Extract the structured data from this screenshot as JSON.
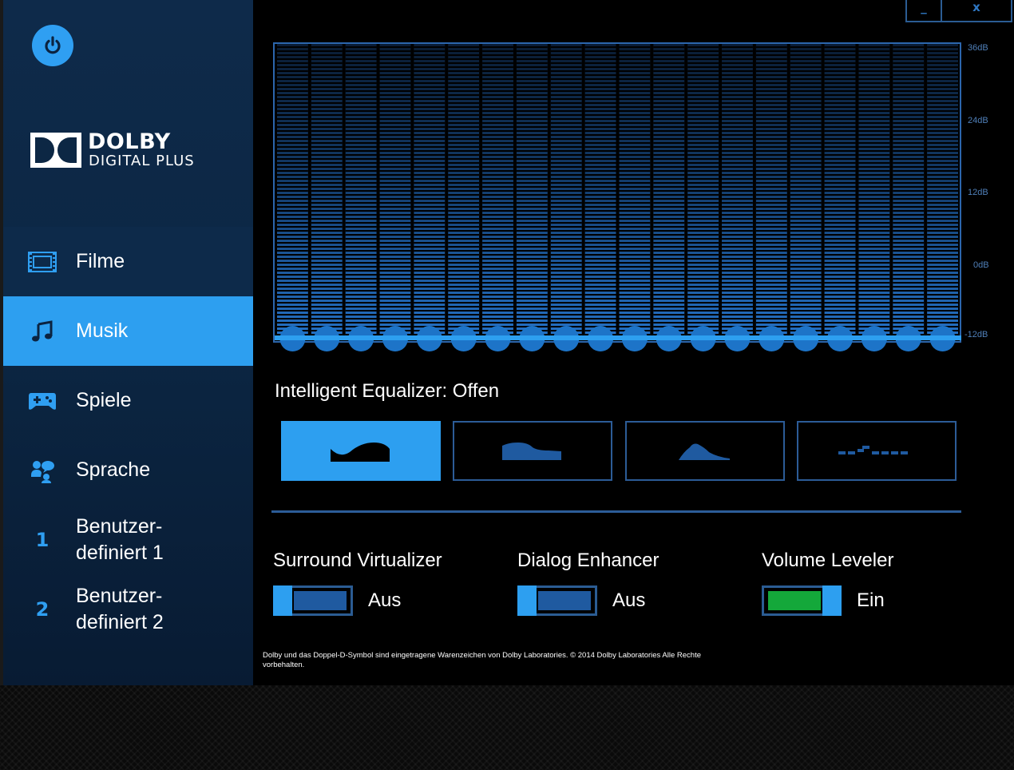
{
  "window": {
    "minimize_label": "_",
    "close_label": "x"
  },
  "brand": {
    "line1": "DOLBY",
    "line2": "DIGITAL PLUS"
  },
  "nav": {
    "items": [
      {
        "label": "Filme",
        "icon": "film-icon"
      },
      {
        "label": "Musik",
        "icon": "music-note-icon",
        "active": true
      },
      {
        "label": "Spiele",
        "icon": "gamepad-icon"
      },
      {
        "label": "Sprache",
        "icon": "voice-icon"
      },
      {
        "num": "1",
        "label_line1": "Benutzer-",
        "label_line2": "definiert 1"
      },
      {
        "num": "2",
        "label_line1": "Benutzer-",
        "label_line2": "definiert 2"
      }
    ]
  },
  "equalizer": {
    "db_labels": [
      "36dB",
      "24dB",
      "12dB",
      "0dB",
      "-12dB"
    ],
    "bands": 20,
    "title": "Intelligent Equalizer: Offen",
    "presets": [
      {
        "icon": "curve-open-icon",
        "active": true
      },
      {
        "icon": "curve-rich-icon"
      },
      {
        "icon": "curve-focused-icon"
      },
      {
        "icon": "curve-flat-icon"
      }
    ]
  },
  "toggles": [
    {
      "label": "Surround Virtualizer",
      "state": "Aus",
      "on": false
    },
    {
      "label": "Dialog Enhancer",
      "state": "Aus",
      "on": false
    },
    {
      "label": "Volume Leveler",
      "state": "Ein",
      "on": true
    }
  ],
  "footer": {
    "text": "Dolby und das Doppel-D-Symbol sind eingetragene Warenzeichen von Dolby Laboratories. © 2014 Dolby Laboratories Alle Rechte vorbehalten."
  },
  "colors": {
    "accent": "#2d9ff0",
    "border": "#2c5c97",
    "on_green": "#14a83a",
    "off_blue": "#1f5aa0"
  }
}
